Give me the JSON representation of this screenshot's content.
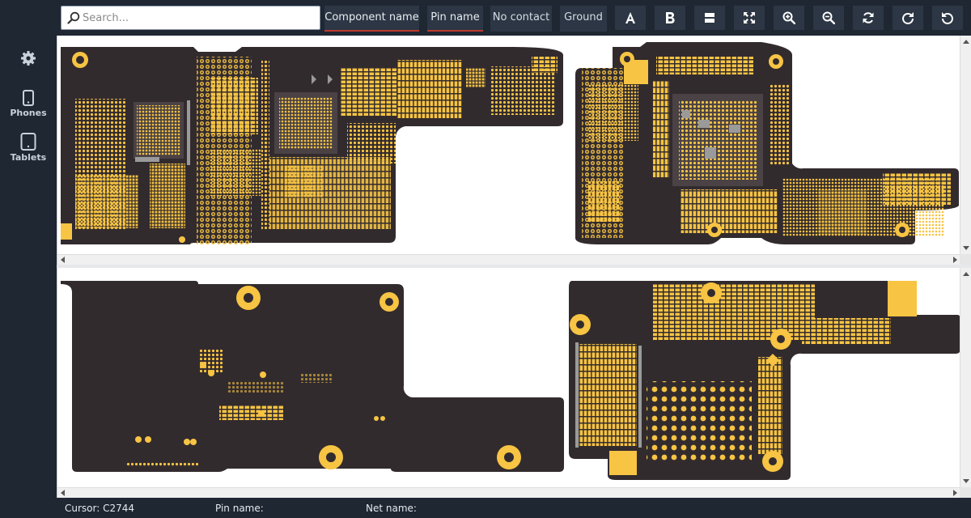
{
  "sidebar": {
    "settings_icon": "gear-icon",
    "items": [
      {
        "label": "Phones",
        "icon": "phone-icon"
      },
      {
        "label": "Tablets",
        "icon": "tablet-icon"
      }
    ]
  },
  "toolbar": {
    "search_placeholder": "Search...",
    "search_value": "",
    "component_name_label": "Component name",
    "pin_name_label": "Pin name",
    "no_contact_label": "No contact",
    "ground_label": "Ground",
    "icons": [
      "font-a-icon",
      "bold-b-icon",
      "split-view-icon",
      "fit-screen-icon",
      "zoom-in-icon",
      "zoom-out-icon",
      "refresh-icon",
      "rotate-cw-icon",
      "rotate-ccw-icon"
    ]
  },
  "status": {
    "cursor": "Cursor: C2744",
    "pin_name": "Pin name:",
    "net_name": "Net name:"
  },
  "colors": {
    "board": "#322b2e",
    "pad": "#f7c443",
    "grey_pad": "#9a9a9a",
    "ui_dark": "#1f2733",
    "button_bg": "#2c3644",
    "active_underline": "#c0392b"
  }
}
